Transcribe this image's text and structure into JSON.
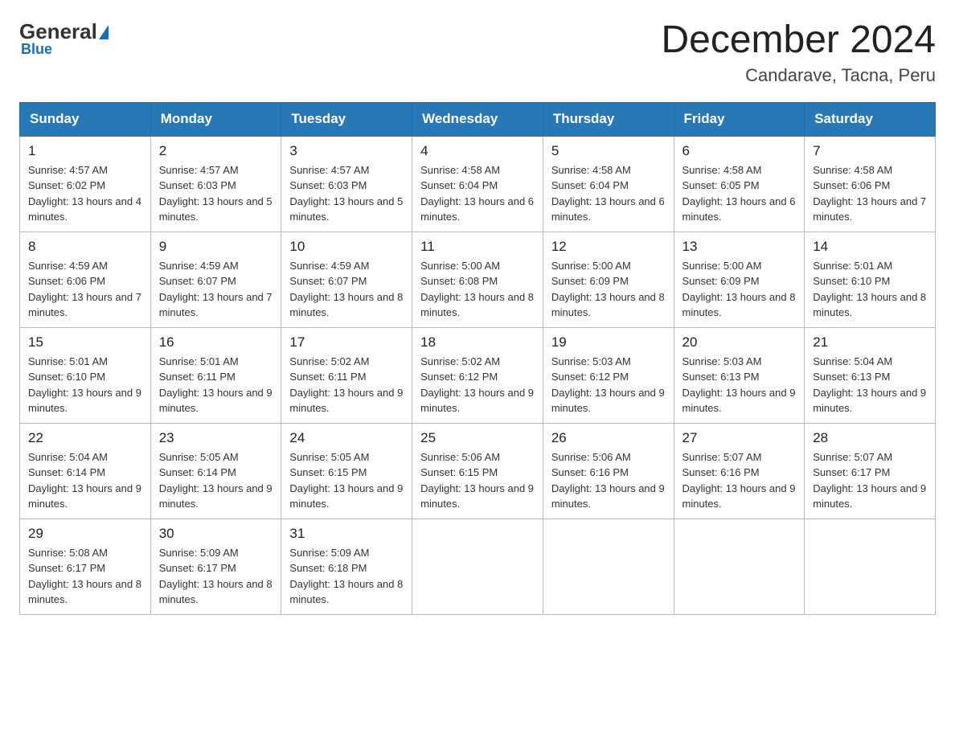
{
  "header": {
    "logo": {
      "general": "General",
      "blue": "Blue"
    },
    "title": "December 2024",
    "location": "Candarave, Tacna, Peru"
  },
  "days_of_week": [
    "Sunday",
    "Monday",
    "Tuesday",
    "Wednesday",
    "Thursday",
    "Friday",
    "Saturday"
  ],
  "weeks": [
    [
      {
        "day": "1",
        "sunrise": "Sunrise: 4:57 AM",
        "sunset": "Sunset: 6:02 PM",
        "daylight": "Daylight: 13 hours and 4 minutes."
      },
      {
        "day": "2",
        "sunrise": "Sunrise: 4:57 AM",
        "sunset": "Sunset: 6:03 PM",
        "daylight": "Daylight: 13 hours and 5 minutes."
      },
      {
        "day": "3",
        "sunrise": "Sunrise: 4:57 AM",
        "sunset": "Sunset: 6:03 PM",
        "daylight": "Daylight: 13 hours and 5 minutes."
      },
      {
        "day": "4",
        "sunrise": "Sunrise: 4:58 AM",
        "sunset": "Sunset: 6:04 PM",
        "daylight": "Daylight: 13 hours and 6 minutes."
      },
      {
        "day": "5",
        "sunrise": "Sunrise: 4:58 AM",
        "sunset": "Sunset: 6:04 PM",
        "daylight": "Daylight: 13 hours and 6 minutes."
      },
      {
        "day": "6",
        "sunrise": "Sunrise: 4:58 AM",
        "sunset": "Sunset: 6:05 PM",
        "daylight": "Daylight: 13 hours and 6 minutes."
      },
      {
        "day": "7",
        "sunrise": "Sunrise: 4:58 AM",
        "sunset": "Sunset: 6:06 PM",
        "daylight": "Daylight: 13 hours and 7 minutes."
      }
    ],
    [
      {
        "day": "8",
        "sunrise": "Sunrise: 4:59 AM",
        "sunset": "Sunset: 6:06 PM",
        "daylight": "Daylight: 13 hours and 7 minutes."
      },
      {
        "day": "9",
        "sunrise": "Sunrise: 4:59 AM",
        "sunset": "Sunset: 6:07 PM",
        "daylight": "Daylight: 13 hours and 7 minutes."
      },
      {
        "day": "10",
        "sunrise": "Sunrise: 4:59 AM",
        "sunset": "Sunset: 6:07 PM",
        "daylight": "Daylight: 13 hours and 8 minutes."
      },
      {
        "day": "11",
        "sunrise": "Sunrise: 5:00 AM",
        "sunset": "Sunset: 6:08 PM",
        "daylight": "Daylight: 13 hours and 8 minutes."
      },
      {
        "day": "12",
        "sunrise": "Sunrise: 5:00 AM",
        "sunset": "Sunset: 6:09 PM",
        "daylight": "Daylight: 13 hours and 8 minutes."
      },
      {
        "day": "13",
        "sunrise": "Sunrise: 5:00 AM",
        "sunset": "Sunset: 6:09 PM",
        "daylight": "Daylight: 13 hours and 8 minutes."
      },
      {
        "day": "14",
        "sunrise": "Sunrise: 5:01 AM",
        "sunset": "Sunset: 6:10 PM",
        "daylight": "Daylight: 13 hours and 8 minutes."
      }
    ],
    [
      {
        "day": "15",
        "sunrise": "Sunrise: 5:01 AM",
        "sunset": "Sunset: 6:10 PM",
        "daylight": "Daylight: 13 hours and 9 minutes."
      },
      {
        "day": "16",
        "sunrise": "Sunrise: 5:01 AM",
        "sunset": "Sunset: 6:11 PM",
        "daylight": "Daylight: 13 hours and 9 minutes."
      },
      {
        "day": "17",
        "sunrise": "Sunrise: 5:02 AM",
        "sunset": "Sunset: 6:11 PM",
        "daylight": "Daylight: 13 hours and 9 minutes."
      },
      {
        "day": "18",
        "sunrise": "Sunrise: 5:02 AM",
        "sunset": "Sunset: 6:12 PM",
        "daylight": "Daylight: 13 hours and 9 minutes."
      },
      {
        "day": "19",
        "sunrise": "Sunrise: 5:03 AM",
        "sunset": "Sunset: 6:12 PM",
        "daylight": "Daylight: 13 hours and 9 minutes."
      },
      {
        "day": "20",
        "sunrise": "Sunrise: 5:03 AM",
        "sunset": "Sunset: 6:13 PM",
        "daylight": "Daylight: 13 hours and 9 minutes."
      },
      {
        "day": "21",
        "sunrise": "Sunrise: 5:04 AM",
        "sunset": "Sunset: 6:13 PM",
        "daylight": "Daylight: 13 hours and 9 minutes."
      }
    ],
    [
      {
        "day": "22",
        "sunrise": "Sunrise: 5:04 AM",
        "sunset": "Sunset: 6:14 PM",
        "daylight": "Daylight: 13 hours and 9 minutes."
      },
      {
        "day": "23",
        "sunrise": "Sunrise: 5:05 AM",
        "sunset": "Sunset: 6:14 PM",
        "daylight": "Daylight: 13 hours and 9 minutes."
      },
      {
        "day": "24",
        "sunrise": "Sunrise: 5:05 AM",
        "sunset": "Sunset: 6:15 PM",
        "daylight": "Daylight: 13 hours and 9 minutes."
      },
      {
        "day": "25",
        "sunrise": "Sunrise: 5:06 AM",
        "sunset": "Sunset: 6:15 PM",
        "daylight": "Daylight: 13 hours and 9 minutes."
      },
      {
        "day": "26",
        "sunrise": "Sunrise: 5:06 AM",
        "sunset": "Sunset: 6:16 PM",
        "daylight": "Daylight: 13 hours and 9 minutes."
      },
      {
        "day": "27",
        "sunrise": "Sunrise: 5:07 AM",
        "sunset": "Sunset: 6:16 PM",
        "daylight": "Daylight: 13 hours and 9 minutes."
      },
      {
        "day": "28",
        "sunrise": "Sunrise: 5:07 AM",
        "sunset": "Sunset: 6:17 PM",
        "daylight": "Daylight: 13 hours and 9 minutes."
      }
    ],
    [
      {
        "day": "29",
        "sunrise": "Sunrise: 5:08 AM",
        "sunset": "Sunset: 6:17 PM",
        "daylight": "Daylight: 13 hours and 8 minutes."
      },
      {
        "day": "30",
        "sunrise": "Sunrise: 5:09 AM",
        "sunset": "Sunset: 6:17 PM",
        "daylight": "Daylight: 13 hours and 8 minutes."
      },
      {
        "day": "31",
        "sunrise": "Sunrise: 5:09 AM",
        "sunset": "Sunset: 6:18 PM",
        "daylight": "Daylight: 13 hours and 8 minutes."
      },
      null,
      null,
      null,
      null
    ]
  ]
}
